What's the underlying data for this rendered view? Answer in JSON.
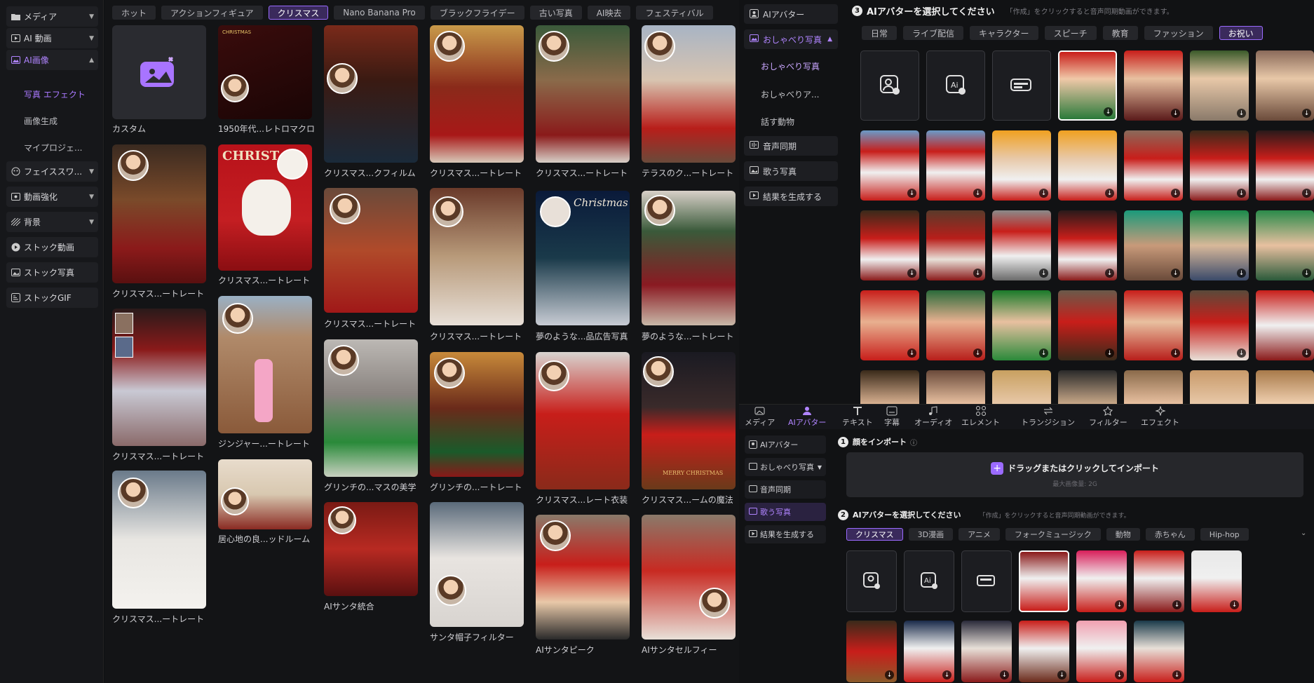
{
  "sidebar": {
    "items": [
      {
        "label": "メディア",
        "icon": "folder-icon"
      },
      {
        "label": "AI 動画",
        "icon": "ai-video-icon"
      },
      {
        "label": "AI画像",
        "icon": "ai-image-icon"
      },
      {
        "label": "フェイススワ...",
        "icon": "face-swap-icon"
      },
      {
        "label": "動画強化",
        "icon": "enhance-icon"
      },
      {
        "label": "背景",
        "icon": "background-icon"
      },
      {
        "label": "ストック動画",
        "icon": "stock-video-icon"
      },
      {
        "label": "ストック写真",
        "icon": "stock-photo-icon"
      },
      {
        "label": "ストックGIF",
        "icon": "stock-gif-icon"
      }
    ],
    "subitems": [
      "写真 エフェクト",
      "画像生成",
      "マイプロジェ..."
    ]
  },
  "gallery": {
    "filters": [
      "ホット",
      "アクションフィギュア",
      "クリスマス",
      "Nano Banana Pro",
      "ブラックフライデー",
      "古い写真",
      "AI映去",
      "フェスティバル"
    ],
    "active_filter": "クリスマス",
    "captions": {
      "custom": "カスタム",
      "retro": "1950年代...レトロマクロ",
      "c1": "クリスマス...ートレート",
      "c2": "クリスマス...ートレート",
      "c3": "クリスマス...ートレート",
      "c4": "クリスマス...ートレート",
      "dog": "クリスマス...ートレート",
      "ginger": "ジンジャー...ートレート",
      "bedroom": "居心地の良...ッドルーム",
      "film": "クリスマス...クフィルム",
      "kid1": "クリスマス...ートレート",
      "grinch_aes": "グリンチの...マスの美学",
      "santa_comb": "AIサンタ統合",
      "girl_tree": "クリスマス...ートレート",
      "baby": "クリスマス...ートレート",
      "grinch_por": "グリンチの...ートレート",
      "santa_hat": "サンタ帽子フィルター",
      "woman_tree": "クリスマス...ートレート",
      "perfume": "夢のような...品広告写真",
      "costume": "クリスマス...レート衣装",
      "santa_peek": "AIサンタピーク",
      "terrace": "テラスのク...ートレート",
      "dreamy": "夢のような...ートレート",
      "globe": "クリスマス...ームの魔法",
      "selfie": "AIサンタセルフィー"
    },
    "text_christmas": "Christmas",
    "text_christ": "CHRIST",
    "text_merry": "MERRY CHRISTMAS"
  },
  "menu": {
    "items": [
      "AIアバター",
      "おしゃべり写真",
      "音声同期",
      "歌う写真",
      "結果を生成する"
    ],
    "subitems": [
      "おしゃべり写真",
      "おしゃべりア...",
      "話す動物"
    ]
  },
  "panel_top": {
    "step": "3",
    "title": "AIアバターを選択してください",
    "hint": "「作成」をクリックすると音声同期動画ができます。",
    "tabs": [
      "日常",
      "ライブ配信",
      "キャラクター",
      "スピーチ",
      "教育",
      "ファッション",
      "お祝い"
    ],
    "active_tab": "お祝い"
  },
  "toolbar": {
    "items": [
      {
        "label": "メディア",
        "icon": "media-icon"
      },
      {
        "label": "AIアバター",
        "icon": "avatar-icon"
      },
      {
        "label": "テキスト",
        "icon": "text-icon"
      },
      {
        "label": "字幕",
        "icon": "subtitle-icon"
      },
      {
        "label": "オーディオ",
        "icon": "audio-icon"
      },
      {
        "label": "エレメント",
        "icon": "element-icon"
      },
      {
        "label": "トランジション",
        "icon": "transition-icon"
      },
      {
        "label": "フィルター",
        "icon": "filter-icon"
      },
      {
        "label": "エフェクト",
        "icon": "effect-icon"
      }
    ]
  },
  "bottom_menu": {
    "items": [
      "AIアバター",
      "おしゃべり写真",
      "音声同期",
      "歌う写真",
      "結果を生成する"
    ]
  },
  "panel_bottom": {
    "step1": "1",
    "import_title": "顔をインポート",
    "import_btn": "ドラッグまたはクリックしてインポート",
    "import_size": "最大画像量: 2G",
    "step2": "2",
    "title": "AIアバターを選択してください",
    "hint": "「作成」をクリックすると音声同期動画ができます。",
    "tabs": [
      "クリスマス",
      "3D漫画",
      "アニメ",
      "フォークミュージック",
      "動物",
      "赤ちゃん",
      "Hip-hop"
    ],
    "active_tab": "クリスマス"
  },
  "colors": {
    "accent": "#9b6bff",
    "bg": "#111214",
    "panel": "#1f2024"
  }
}
